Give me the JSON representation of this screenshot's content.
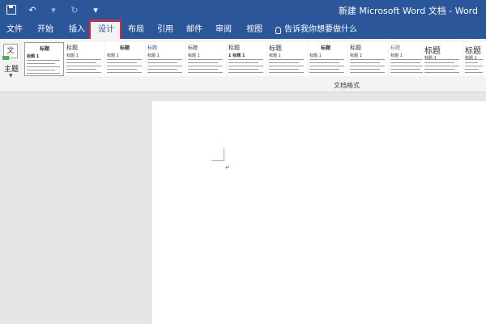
{
  "window": {
    "title": "新建 Microsoft Word 文档 - Word"
  },
  "quick_access": {
    "icons": [
      "save-icon",
      "undo-icon",
      "undo-dropdown-icon",
      "redo-icon",
      "customize-icon"
    ]
  },
  "tabs": [
    {
      "label": "文件"
    },
    {
      "label": "开始"
    },
    {
      "label": "插入"
    },
    {
      "label": "设计",
      "active": true
    },
    {
      "label": "布局"
    },
    {
      "label": "引用"
    },
    {
      "label": "邮件"
    },
    {
      "label": "审阅"
    },
    {
      "label": "视图"
    }
  ],
  "tellme": {
    "label": "告诉我你想要做什么"
  },
  "ribbon": {
    "theme_label": "主题",
    "theme_icon_text": "文",
    "group_label": "文档格式",
    "styles": [
      {
        "title": "标题",
        "heading": "标题 1"
      },
      {
        "title": "标题",
        "heading": "标题 1"
      },
      {
        "title": "标题",
        "heading": "标题 1"
      },
      {
        "title": "标题",
        "heading": "标题 1"
      },
      {
        "title": "标题",
        "heading": "标题 1"
      },
      {
        "title": "标题",
        "heading": "1 标题 1"
      },
      {
        "title": "标题",
        "heading": "标题 1"
      },
      {
        "title": "标题",
        "heading": "标题 1"
      },
      {
        "title": "标题",
        "heading": "标题 1"
      },
      {
        "title": "标题",
        "heading": "标题 1"
      },
      {
        "title": "标题",
        "heading": "标题 1"
      },
      {
        "title": "标题",
        "heading": "标题 1"
      }
    ]
  },
  "document": {
    "paragraph_mark": "↵"
  },
  "colors": {
    "accent": "#2b579a",
    "highlight": "#e0243b"
  }
}
